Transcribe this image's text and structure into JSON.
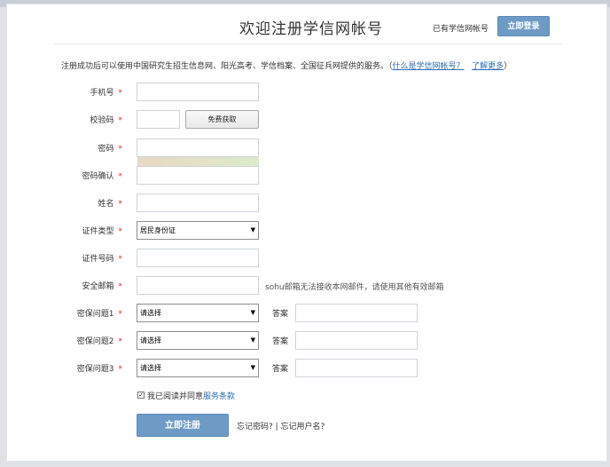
{
  "header": {
    "title": "欢迎注册学信网帐号",
    "have_account": "已有学信网帐号",
    "login_button": "立即登录"
  },
  "intro": {
    "text": "注册成功后可以使用中国研究生招生信息网、阳光高考、学信档案、全国征兵网提供的服务。（",
    "link_what": "什么是学信网帐号？",
    "link_more": "了解更多",
    "close": "）"
  },
  "form": {
    "phone_label": "手机号",
    "code_label": "校验码",
    "code_button": "免费获取",
    "password_label": "密码",
    "password_confirm_label": "密码确认",
    "name_label": "姓名",
    "id_type_label": "证件类型",
    "id_type_value": "居民身份证",
    "id_number_label": "证件号码",
    "email_label": "安全邮箱",
    "email_hint": "sohu邮箱无法接收本网邮件，请使用其他有效邮箱",
    "q1_label": "密保问题1",
    "q2_label": "密保问题2",
    "q3_label": "密保问题3",
    "q_placeholder": "请选择",
    "answer_label": "答案",
    "required_mark": "*"
  },
  "agreement": {
    "text": "我已阅读并同意",
    "link": "服务条款",
    "checked": "✓"
  },
  "actions": {
    "submit": "立即注册",
    "forgot_password": "忘记密码?",
    "separator": " | ",
    "forgot_username": "忘记用户名?"
  }
}
